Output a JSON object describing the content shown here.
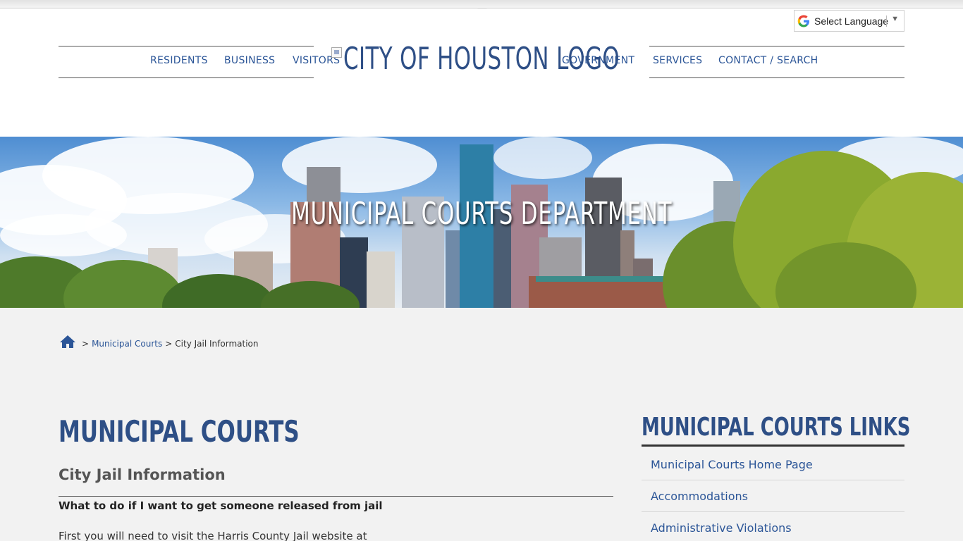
{
  "translate": {
    "label": "Select Language",
    "arrow": "▼"
  },
  "nav": {
    "left": [
      "RESIDENTS",
      "BUSINESS",
      "VISITORS"
    ],
    "right": [
      "GOVERNMENT",
      "SERVICES",
      "CONTACT / SEARCH"
    ],
    "logo_alt": "CITY OF HOUSTON LOGO"
  },
  "hero": {
    "title": "MUNICIPAL COURTS DEPARTMENT"
  },
  "breadcrumb": {
    "sep": ">",
    "link": "Municipal Courts",
    "current": "City Jail Information"
  },
  "main": {
    "title": "MUNICIPAL COURTS",
    "subtitle": "City Jail Information",
    "question": "What to do if I want to get someone released from jail",
    "paragraph": "First you will need to visit the Harris County Jail website at"
  },
  "sidebar": {
    "title": "MUNICIPAL COURTS LINKS",
    "items": [
      "Municipal Courts Home Page",
      "Accommodations",
      "Administrative Violations"
    ]
  },
  "colors": {
    "brand_blue": "#2e4f86",
    "link_blue": "#2b5597"
  }
}
